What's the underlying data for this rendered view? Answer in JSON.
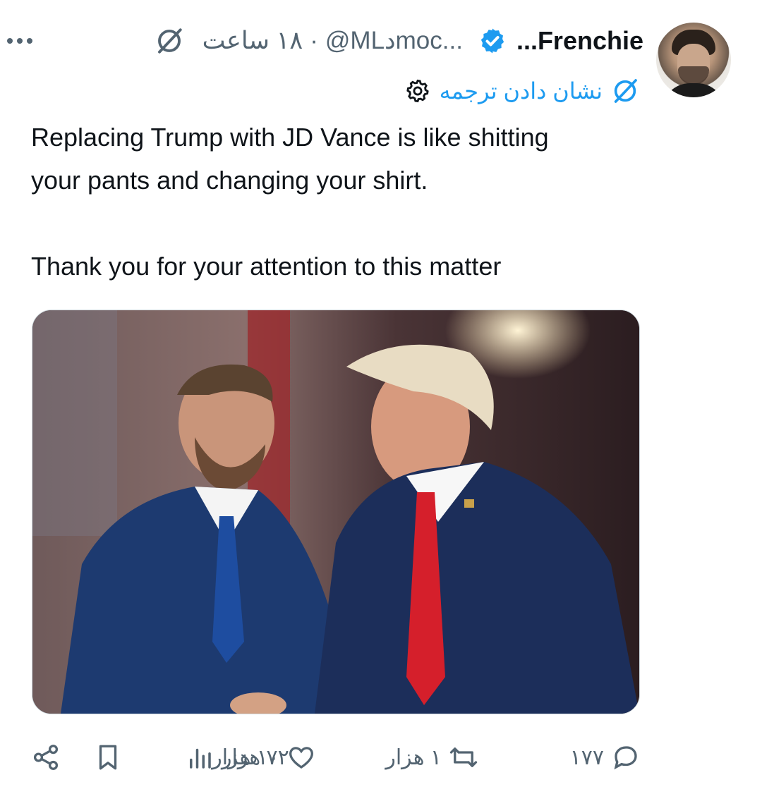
{
  "tweet": {
    "author": {
      "display_name": "...Frenchie",
      "handle": "@MLدmoc...",
      "verified": true
    },
    "time": "۱۸ ساعت",
    "separator": "·",
    "translate_label": "نشان دادن ترجمه",
    "text": {
      "line1": "Replacing Trump with JD Vance is like shitting",
      "line2": "your pants and changing your shirt.",
      "line3": "Thank you for your attention to this matter"
    },
    "media": {
      "alt_icon": "photo-two-men-shaking-hands"
    },
    "actions": {
      "replies": "۱۷۷",
      "retweets": "۱ هزار",
      "likes": "۱۰ هزار",
      "views": "۷۲ هزار"
    }
  },
  "colors": {
    "accent": "#1d9bf0",
    "secondary_text": "#536471",
    "primary_text": "#0f1419"
  },
  "icons": {
    "more": "more-icon",
    "grok": "grok-icon",
    "verified": "verified-badge-icon",
    "settings": "settings-gear-icon",
    "reply": "reply-icon",
    "retweet": "retweet-icon",
    "like": "heart-icon",
    "views": "views-bar-icon",
    "bookmark": "bookmark-icon",
    "share": "share-icon"
  }
}
